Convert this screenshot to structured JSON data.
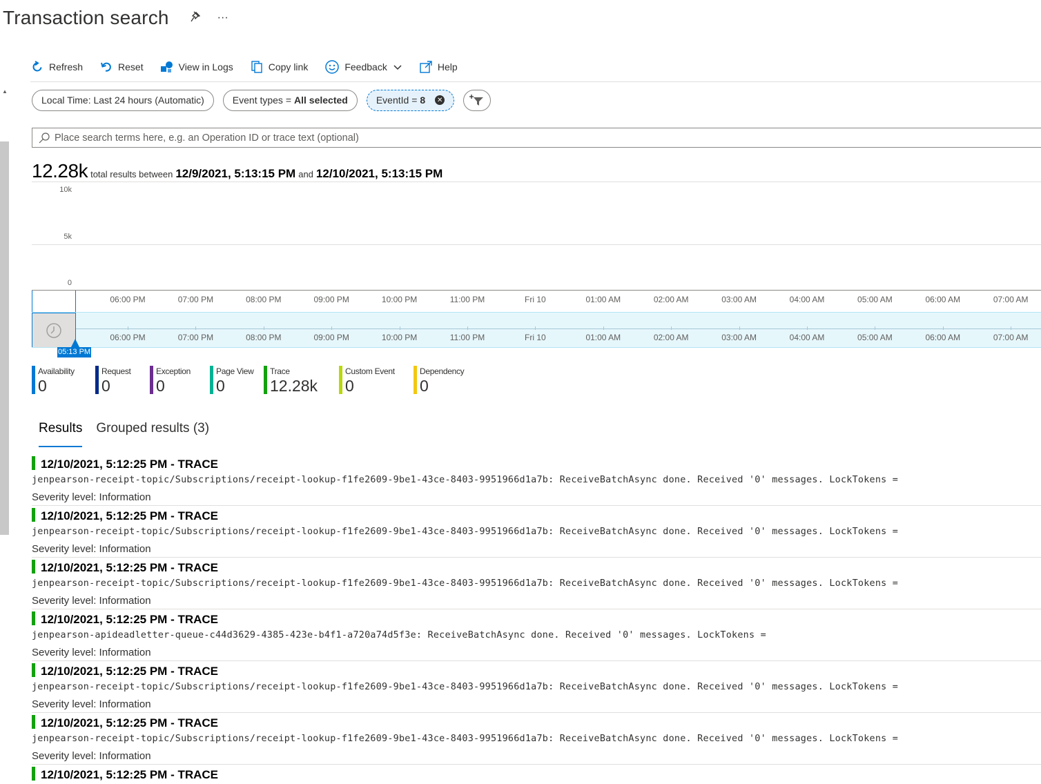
{
  "header": {
    "title": "Transaction search",
    "more_glyph": "···"
  },
  "toolbar": {
    "refresh": "Refresh",
    "reset": "Reset",
    "view_in_logs": "View in Logs",
    "copy_link": "Copy link",
    "feedback": "Feedback",
    "help": "Help"
  },
  "filters": {
    "time": "Local Time: Last 24 hours (Automatic)",
    "event_types_label": "Event types =",
    "event_types_value": "All selected",
    "eventid_label": "EventId =",
    "eventid_value": "8"
  },
  "search": {
    "placeholder": "Place search terms here, e.g. an Operation ID or trace text (optional)"
  },
  "summary": {
    "count": "12.28k",
    "text_between": "total results between",
    "start": "12/9/2021, 5:13:15 PM",
    "text_and": "and",
    "end": "12/10/2021, 5:13:15 PM"
  },
  "chart_data": {
    "type": "bar",
    "y_ticks": [
      "10k",
      "5k",
      "0"
    ],
    "ylim": [
      0,
      10000
    ],
    "x_ticks": [
      "06:00 PM",
      "07:00 PM",
      "08:00 PM",
      "09:00 PM",
      "10:00 PM",
      "11:00 PM",
      "Fri 10",
      "01:00 AM",
      "02:00 AM",
      "03:00 AM",
      "04:00 AM",
      "05:00 AM",
      "06:00 AM",
      "07:00 AM"
    ],
    "time_marker": "05:13 PM"
  },
  "legend": [
    {
      "name": "Availability",
      "value": "0",
      "color": "#0078d4"
    },
    {
      "name": "Request",
      "value": "0",
      "color": "#002a88"
    },
    {
      "name": "Exception",
      "value": "0",
      "color": "#6b2d8f"
    },
    {
      "name": "Page View",
      "value": "0",
      "color": "#00b294"
    },
    {
      "name": "Trace",
      "value": "12.28k",
      "color": "#13a10e"
    },
    {
      "name": "Custom Event",
      "value": "0",
      "color": "#bad80a"
    },
    {
      "name": "Dependency",
      "value": "0",
      "color": "#f2c811"
    }
  ],
  "tabs": {
    "results": "Results",
    "grouped": "Grouped results (3)"
  },
  "results": [
    {
      "header": "12/10/2021, 5:12:25 PM - TRACE",
      "message": "jenpearson-receipt-topic/Subscriptions/receipt-lookup-f1fe2609-9be1-43ce-8403-9951966d1a7b: ReceiveBatchAsync done. Received '0' messages. LockTokens =",
      "severity": "Severity level: Information"
    },
    {
      "header": "12/10/2021, 5:12:25 PM - TRACE",
      "message": "jenpearson-receipt-topic/Subscriptions/receipt-lookup-f1fe2609-9be1-43ce-8403-9951966d1a7b: ReceiveBatchAsync done. Received '0' messages. LockTokens =",
      "severity": "Severity level: Information"
    },
    {
      "header": "12/10/2021, 5:12:25 PM - TRACE",
      "message": "jenpearson-receipt-topic/Subscriptions/receipt-lookup-f1fe2609-9be1-43ce-8403-9951966d1a7b: ReceiveBatchAsync done. Received '0' messages. LockTokens =",
      "severity": "Severity level: Information"
    },
    {
      "header": "12/10/2021, 5:12:25 PM - TRACE",
      "message": "jenpearson-apideadletter-queue-c44d3629-4385-423e-b4f1-a720a74d5f3e: ReceiveBatchAsync done. Received '0' messages. LockTokens =",
      "severity": "Severity level: Information"
    },
    {
      "header": "12/10/2021, 5:12:25 PM - TRACE",
      "message": "jenpearson-receipt-topic/Subscriptions/receipt-lookup-f1fe2609-9be1-43ce-8403-9951966d1a7b: ReceiveBatchAsync done. Received '0' messages. LockTokens =",
      "severity": "Severity level: Information"
    },
    {
      "header": "12/10/2021, 5:12:25 PM - TRACE",
      "message": "jenpearson-receipt-topic/Subscriptions/receipt-lookup-f1fe2609-9be1-43ce-8403-9951966d1a7b: ReceiveBatchAsync done. Received '0' messages. LockTokens =",
      "severity": "Severity level: Information"
    },
    {
      "header": "12/10/2021, 5:12:25 PM - TRACE",
      "message": "",
      "severity": ""
    }
  ]
}
